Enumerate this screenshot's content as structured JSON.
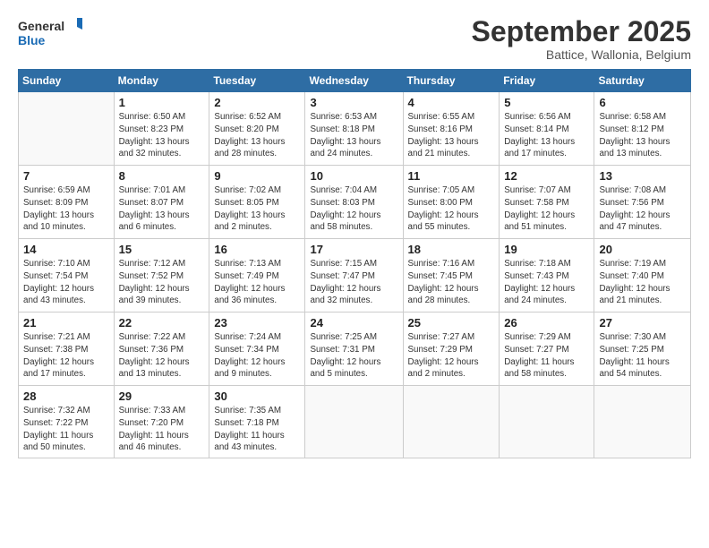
{
  "logo": {
    "line1": "General",
    "line2": "Blue"
  },
  "title": "September 2025",
  "subtitle": "Battice, Wallonia, Belgium",
  "weekdays": [
    "Sunday",
    "Monday",
    "Tuesday",
    "Wednesday",
    "Thursday",
    "Friday",
    "Saturday"
  ],
  "weeks": [
    [
      {
        "day": "",
        "info": ""
      },
      {
        "day": "1",
        "info": "Sunrise: 6:50 AM\nSunset: 8:23 PM\nDaylight: 13 hours\nand 32 minutes."
      },
      {
        "day": "2",
        "info": "Sunrise: 6:52 AM\nSunset: 8:20 PM\nDaylight: 13 hours\nand 28 minutes."
      },
      {
        "day": "3",
        "info": "Sunrise: 6:53 AM\nSunset: 8:18 PM\nDaylight: 13 hours\nand 24 minutes."
      },
      {
        "day": "4",
        "info": "Sunrise: 6:55 AM\nSunset: 8:16 PM\nDaylight: 13 hours\nand 21 minutes."
      },
      {
        "day": "5",
        "info": "Sunrise: 6:56 AM\nSunset: 8:14 PM\nDaylight: 13 hours\nand 17 minutes."
      },
      {
        "day": "6",
        "info": "Sunrise: 6:58 AM\nSunset: 8:12 PM\nDaylight: 13 hours\nand 13 minutes."
      }
    ],
    [
      {
        "day": "7",
        "info": "Sunrise: 6:59 AM\nSunset: 8:09 PM\nDaylight: 13 hours\nand 10 minutes."
      },
      {
        "day": "8",
        "info": "Sunrise: 7:01 AM\nSunset: 8:07 PM\nDaylight: 13 hours\nand 6 minutes."
      },
      {
        "day": "9",
        "info": "Sunrise: 7:02 AM\nSunset: 8:05 PM\nDaylight: 13 hours\nand 2 minutes."
      },
      {
        "day": "10",
        "info": "Sunrise: 7:04 AM\nSunset: 8:03 PM\nDaylight: 12 hours\nand 58 minutes."
      },
      {
        "day": "11",
        "info": "Sunrise: 7:05 AM\nSunset: 8:00 PM\nDaylight: 12 hours\nand 55 minutes."
      },
      {
        "day": "12",
        "info": "Sunrise: 7:07 AM\nSunset: 7:58 PM\nDaylight: 12 hours\nand 51 minutes."
      },
      {
        "day": "13",
        "info": "Sunrise: 7:08 AM\nSunset: 7:56 PM\nDaylight: 12 hours\nand 47 minutes."
      }
    ],
    [
      {
        "day": "14",
        "info": "Sunrise: 7:10 AM\nSunset: 7:54 PM\nDaylight: 12 hours\nand 43 minutes."
      },
      {
        "day": "15",
        "info": "Sunrise: 7:12 AM\nSunset: 7:52 PM\nDaylight: 12 hours\nand 39 minutes."
      },
      {
        "day": "16",
        "info": "Sunrise: 7:13 AM\nSunset: 7:49 PM\nDaylight: 12 hours\nand 36 minutes."
      },
      {
        "day": "17",
        "info": "Sunrise: 7:15 AM\nSunset: 7:47 PM\nDaylight: 12 hours\nand 32 minutes."
      },
      {
        "day": "18",
        "info": "Sunrise: 7:16 AM\nSunset: 7:45 PM\nDaylight: 12 hours\nand 28 minutes."
      },
      {
        "day": "19",
        "info": "Sunrise: 7:18 AM\nSunset: 7:43 PM\nDaylight: 12 hours\nand 24 minutes."
      },
      {
        "day": "20",
        "info": "Sunrise: 7:19 AM\nSunset: 7:40 PM\nDaylight: 12 hours\nand 21 minutes."
      }
    ],
    [
      {
        "day": "21",
        "info": "Sunrise: 7:21 AM\nSunset: 7:38 PM\nDaylight: 12 hours\nand 17 minutes."
      },
      {
        "day": "22",
        "info": "Sunrise: 7:22 AM\nSunset: 7:36 PM\nDaylight: 12 hours\nand 13 minutes."
      },
      {
        "day": "23",
        "info": "Sunrise: 7:24 AM\nSunset: 7:34 PM\nDaylight: 12 hours\nand 9 minutes."
      },
      {
        "day": "24",
        "info": "Sunrise: 7:25 AM\nSunset: 7:31 PM\nDaylight: 12 hours\nand 5 minutes."
      },
      {
        "day": "25",
        "info": "Sunrise: 7:27 AM\nSunset: 7:29 PM\nDaylight: 12 hours\nand 2 minutes."
      },
      {
        "day": "26",
        "info": "Sunrise: 7:29 AM\nSunset: 7:27 PM\nDaylight: 11 hours\nand 58 minutes."
      },
      {
        "day": "27",
        "info": "Sunrise: 7:30 AM\nSunset: 7:25 PM\nDaylight: 11 hours\nand 54 minutes."
      }
    ],
    [
      {
        "day": "28",
        "info": "Sunrise: 7:32 AM\nSunset: 7:22 PM\nDaylight: 11 hours\nand 50 minutes."
      },
      {
        "day": "29",
        "info": "Sunrise: 7:33 AM\nSunset: 7:20 PM\nDaylight: 11 hours\nand 46 minutes."
      },
      {
        "day": "30",
        "info": "Sunrise: 7:35 AM\nSunset: 7:18 PM\nDaylight: 11 hours\nand 43 minutes."
      },
      {
        "day": "",
        "info": ""
      },
      {
        "day": "",
        "info": ""
      },
      {
        "day": "",
        "info": ""
      },
      {
        "day": "",
        "info": ""
      }
    ]
  ]
}
